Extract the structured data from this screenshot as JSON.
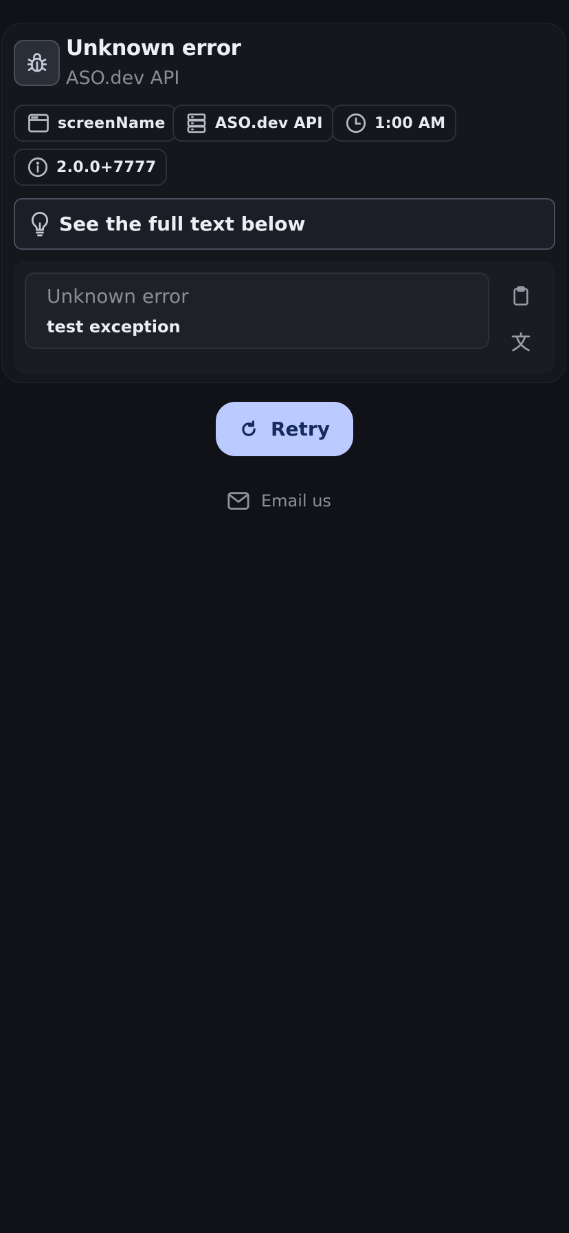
{
  "error": {
    "title": "Unknown error",
    "source": "ASO.dev API"
  },
  "chips": [
    {
      "icon": "browser-window-icon",
      "label": "screenName"
    },
    {
      "icon": "server-icon",
      "label": "ASO.dev API"
    },
    {
      "icon": "clock-icon",
      "label": "1:00 AM"
    },
    {
      "icon": "info-icon",
      "label": "2.0.0+7777"
    }
  ],
  "hint": {
    "icon": "lightbulb-icon",
    "text": "See the full text below"
  },
  "message": {
    "title": "Unknown error",
    "body": "test exception",
    "copy_icon": "clipboard-icon",
    "translate_icon": "translate-icon"
  },
  "actions": {
    "retry_label": "Retry",
    "retry_icon": "refresh-icon",
    "email_label": "Email us",
    "email_icon": "mail-icon"
  },
  "colors": {
    "background": "#111218",
    "card": "#15171d",
    "accent": "#bccbff",
    "accent_text": "#172a5c",
    "muted_text": "#8b8e96"
  }
}
